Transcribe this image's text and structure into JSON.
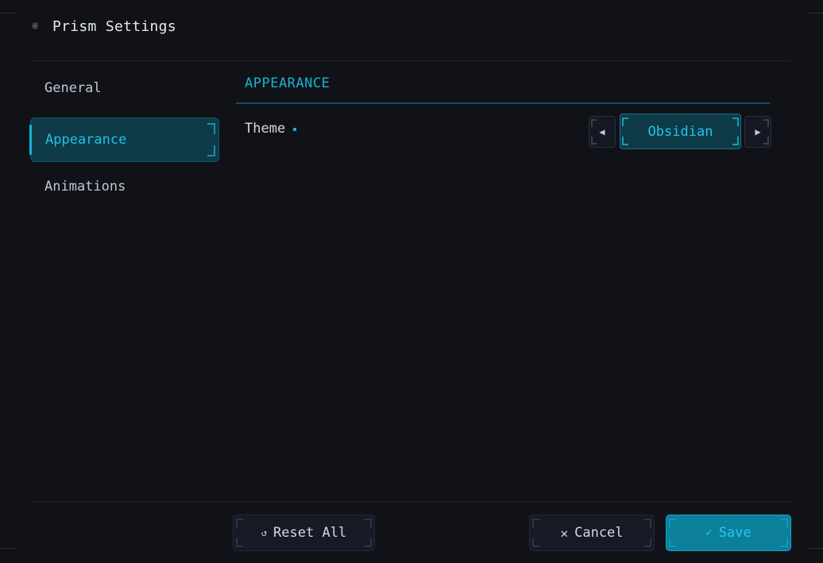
{
  "window": {
    "title": "Prism Settings",
    "title_icon": "gear-icon"
  },
  "sidebar": {
    "items": [
      {
        "label": "General",
        "active": false
      },
      {
        "label": "Appearance",
        "active": true
      },
      {
        "label": "Animations",
        "active": false
      }
    ]
  },
  "main": {
    "section_title": "APPEARANCE",
    "settings": [
      {
        "label": "Theme",
        "value": "Obsidian",
        "prev_icon": "arrow-left-icon",
        "next_icon": "arrow-right-icon"
      }
    ]
  },
  "footer": {
    "reset_label": "Reset All",
    "reset_icon": "reset-icon",
    "cancel_label": "Cancel",
    "cancel_icon": "close-icon",
    "save_label": "Save",
    "save_icon": "check-icon"
  },
  "colors": {
    "background": "#111218",
    "accent": "#17b2d4",
    "active_fill": "#0f3a48",
    "primary_button": "#0b7f9c"
  }
}
